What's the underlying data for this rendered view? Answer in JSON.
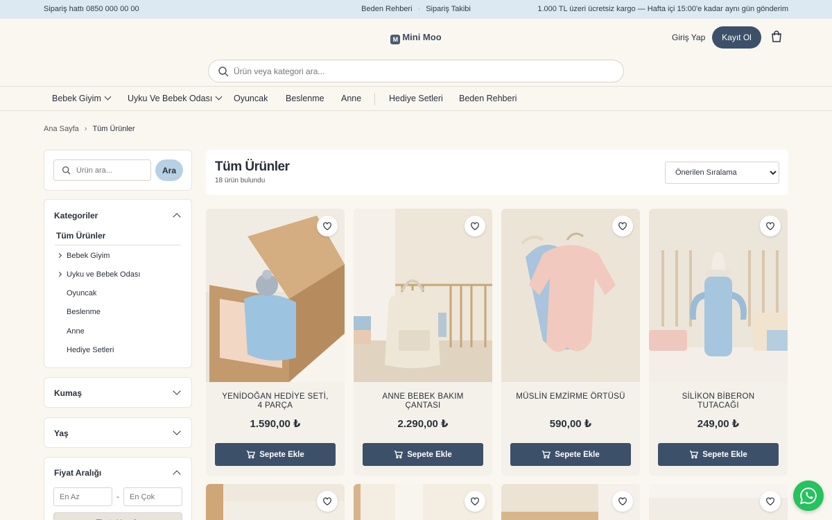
{
  "topbar": {
    "phone": "Sipariş hattı 0850 000 00 00",
    "links": [
      "Beden Rehberi",
      "Sipariş Takibi"
    ],
    "shipping": "1.000 TL üzeri ücretsiz kargo — Hafta içi 15:00'e kadar aynı gün gönderim"
  },
  "header": {
    "logo_mark": "M",
    "logo": "Mini Moo",
    "login": "Giriş Yap",
    "register": "Kayıt Ol",
    "search_placeholder": "Ürün veya kategori ara..."
  },
  "nav": {
    "items": [
      "Bebek Giyim",
      "Uyku Ve Bebek Odası",
      "Oyuncak",
      "Beslenme",
      "Anne",
      "Hediye Setleri",
      "Beden Rehberi"
    ]
  },
  "breadcrumb": {
    "home": "Ana Sayfa",
    "current": "Tüm Ürünler"
  },
  "sidebar": {
    "search_placeholder": "Ürün ara...",
    "search_button": "Ara",
    "categories_title": "Kategoriler",
    "all_label": "Tüm Ürünler",
    "categories": [
      "Bebek Giyim",
      "Uyku ve Bebek Odası",
      "Oyuncak",
      "Beslenme",
      "Anne",
      "Hediye Setleri"
    ],
    "fabric_title": "Kumaş",
    "age_title": "Yaş",
    "price_title": "Fiyat Aralığı",
    "price_min_placeholder": "En Az",
    "price_max_placeholder": "En Çok",
    "price_separator": "-",
    "price_button": "Fiyatı Uygula"
  },
  "listing": {
    "title": "Tüm Ürünler",
    "count": "18 ürün bulundu",
    "sort": "Önerilen Sıralama"
  },
  "products": [
    {
      "name": "YENİDOĞAN HEDİYE SETİ, 4 PARÇA",
      "price": "1.590,00 ₺",
      "button": "Sepete Ekle"
    },
    {
      "name": "ANNE BEBEK BAKIM ÇANTASI",
      "price": "2.290,00 ₺",
      "button": "Sepete Ekle"
    },
    {
      "name": "MÜSLİN EMZİRME ÖRTÜSÜ",
      "price": "590,00 ₺",
      "button": "Sepete Ekle"
    },
    {
      "name": "SİLİKON BİBERON TUTACAĞI",
      "price": "249,00 ₺",
      "button": "Sepete Ekle"
    }
  ],
  "colors": {
    "topbar": "#dce8f2",
    "accent": "#3d5069",
    "background": "#faf7f1",
    "whatsapp": "#25c25d"
  }
}
